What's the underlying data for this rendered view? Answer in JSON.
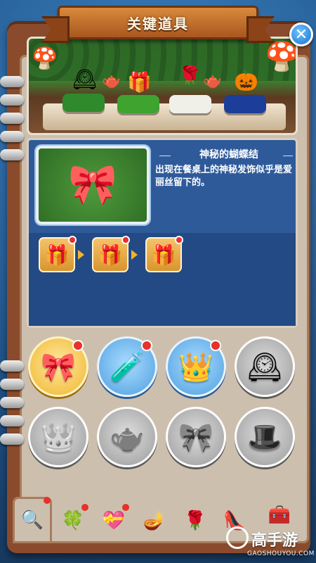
{
  "header": {
    "title": "关键道具",
    "close_icon": "close-icon"
  },
  "scene": {
    "items": [
      "clock-icon",
      "gift-stack-icon",
      "rose-dome-icon",
      "pumpkin-carriage-icon"
    ]
  },
  "selected_item": {
    "name": "神秘的蝴蝶结",
    "description": "出现在餐桌上的神秘发饰似乎是爱丽丝留下的。",
    "icon": "pink-bow-icon"
  },
  "reward_chain": {
    "steps": [
      {
        "icon": "gift-box-icon",
        "has_badge": true
      },
      {
        "icon": "gift-box-icon",
        "has_badge": true
      },
      {
        "icon": "gift-box-icon",
        "has_badge": true
      }
    ]
  },
  "item_grid": [
    {
      "icon": "pink-bow-icon",
      "state": "selected",
      "has_badge": true
    },
    {
      "icon": "potion-bottle-icon",
      "state": "unlocked",
      "has_badge": true
    },
    {
      "icon": "golden-crown-icon",
      "state": "unlocked",
      "has_badge": true
    },
    {
      "icon": "clock-icon",
      "state": "locked",
      "has_badge": false
    },
    {
      "icon": "tiara-icon",
      "state": "locked",
      "has_badge": false
    },
    {
      "icon": "teapot-icon",
      "state": "locked",
      "has_badge": false
    },
    {
      "icon": "ribbon-icon",
      "state": "locked",
      "has_badge": false
    },
    {
      "icon": "cards-hat-icon",
      "state": "locked",
      "has_badge": false
    }
  ],
  "tabs": [
    {
      "icon": "magnifier-icon",
      "active": true,
      "has_badge": true
    },
    {
      "icon": "clover-icon",
      "active": false,
      "has_badge": true
    },
    {
      "icon": "heart-icon",
      "active": false,
      "has_badge": true
    },
    {
      "icon": "magic-lamp-icon",
      "active": false,
      "has_badge": false
    },
    {
      "icon": "rose-icon",
      "active": false,
      "has_badge": false
    },
    {
      "icon": "glass-slipper-icon",
      "active": false,
      "has_badge": false
    },
    {
      "icon": "treasure-chest-icon",
      "active": false,
      "has_badge": false
    }
  ],
  "watermark": {
    "brand": "高手游",
    "url": "GAOSHOUYOU.COM"
  },
  "colors": {
    "badge_red": "#e5322b",
    "panel_blue": "#2e5a9a",
    "binder_brown": "#8a4b2c",
    "selected_gold": "#f0b52e"
  }
}
